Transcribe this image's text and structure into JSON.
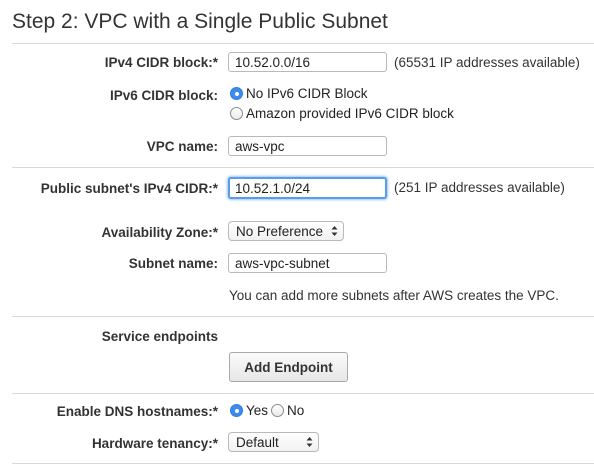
{
  "page_title": "Step 2: VPC with a Single Public Subnet",
  "ipv4_cidr": {
    "label": "IPv4 CIDR block:*",
    "value": "10.52.0.0/16",
    "note": "(65531 IP addresses available)"
  },
  "ipv6_cidr": {
    "label": "IPv6 CIDR block:",
    "options": [
      "No IPv6 CIDR Block",
      "Amazon provided IPv6 CIDR block"
    ],
    "selected": "No IPv6 CIDR Block"
  },
  "vpc_name": {
    "label": "VPC name:",
    "value": "aws-vpc"
  },
  "public_subnet_cidr": {
    "label": "Public subnet's IPv4 CIDR:*",
    "value": "10.52.1.0/24",
    "note": "(251 IP addresses available)"
  },
  "availability_zone": {
    "label": "Availability Zone:*",
    "value": "No Preference"
  },
  "subnet_name": {
    "label": "Subnet name:",
    "value": "aws-vpc-subnet",
    "note": "You can add more subnets after AWS creates the VPC."
  },
  "service_endpoints": {
    "label": "Service endpoints",
    "button_label": "Add Endpoint"
  },
  "dns_hostnames": {
    "label": "Enable DNS hostnames:*",
    "options": [
      "Yes",
      "No"
    ],
    "selected": "Yes"
  },
  "hardware_tenancy": {
    "label": "Hardware tenancy:*",
    "value": "Default"
  },
  "colors": {
    "radio_selected": "#3b8bf0",
    "focus_ring": "#5a9ce8",
    "divider": "#d9d9d9"
  }
}
